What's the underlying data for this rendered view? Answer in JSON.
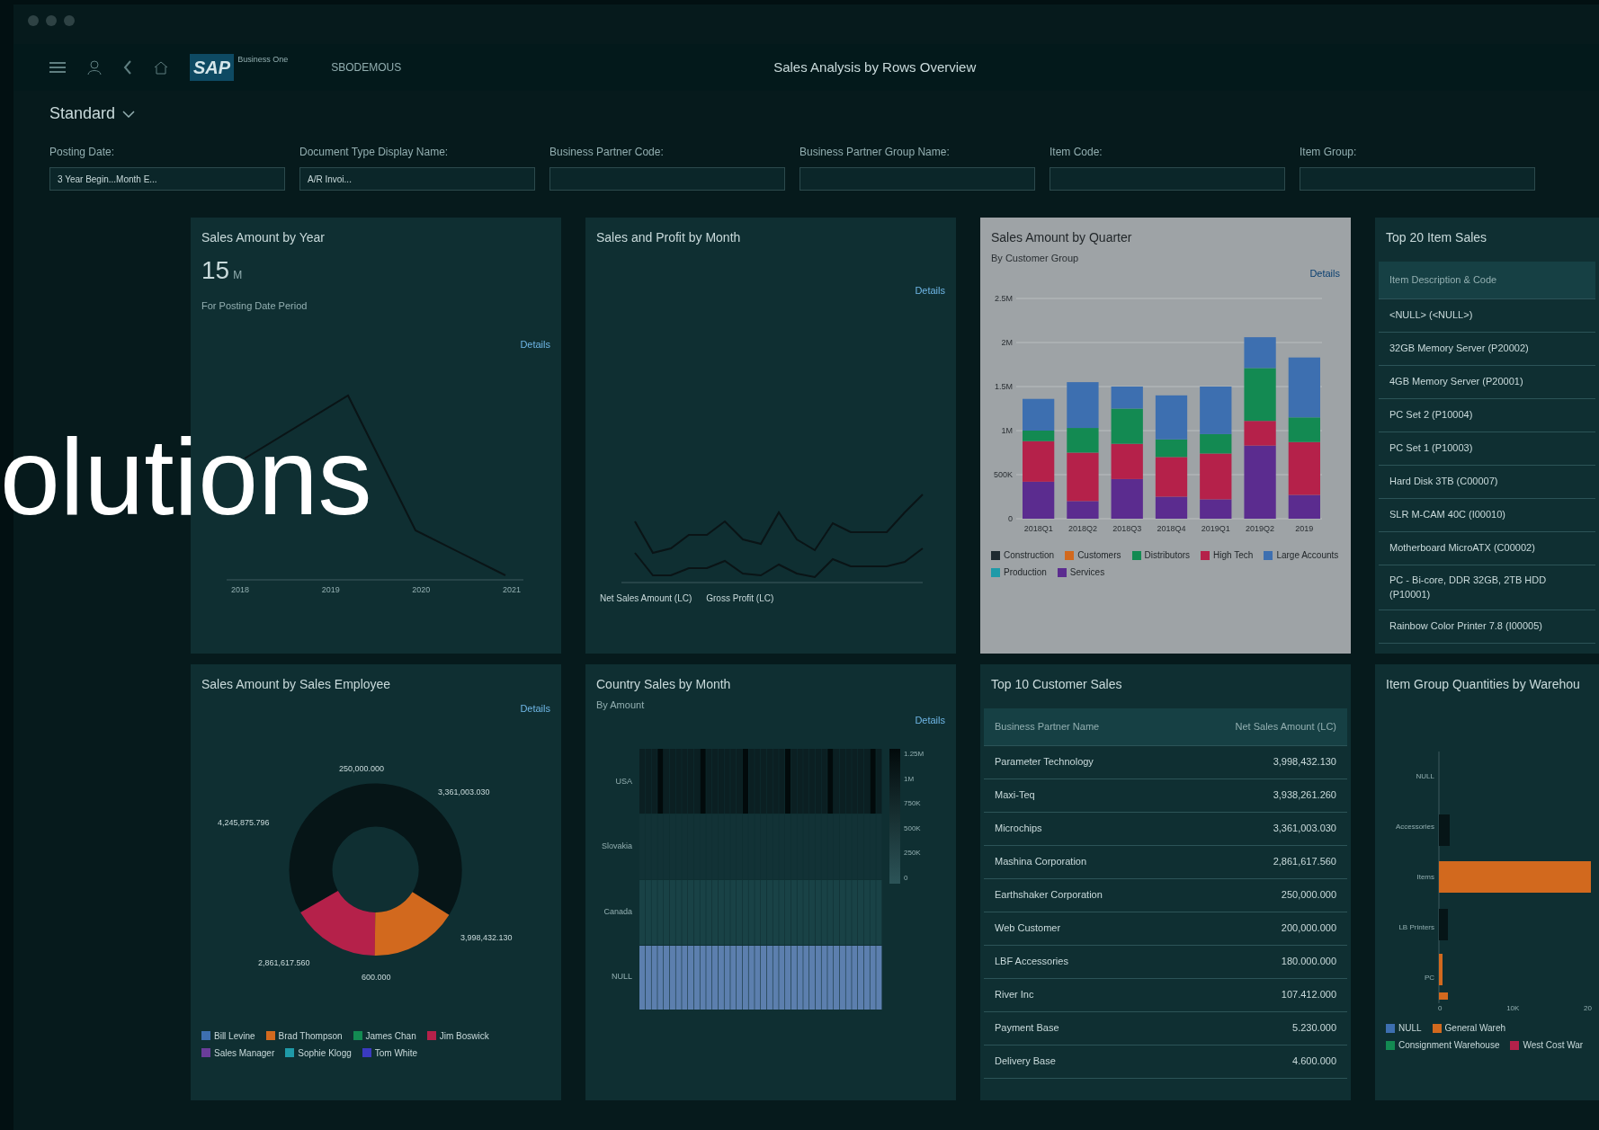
{
  "app_bar": {
    "brand": "SAP",
    "brand_sub": "Business One",
    "company": "SBODEMOUS",
    "title": "Sales Analysis by Rows Overview"
  },
  "variant": "Standard",
  "filters": [
    {
      "label": "Posting Date:",
      "value": "3 Year Begin...Month E..."
    },
    {
      "label": "Document Type Display Name:",
      "value": "A/R Invoi..."
    },
    {
      "label": "Business Partner Code:"
    },
    {
      "label": "Business Partner Group Name:"
    },
    {
      "label": "Item Code:"
    },
    {
      "label": "Item Group:"
    }
  ],
  "headline": "olutions",
  "cards": [
    {
      "kind": "kpi_line",
      "title": "Sales Amount by Year",
      "kpi": "15",
      "unit": "M",
      "subtitle": "For Posting Date Period",
      "link": "Details",
      "x_labels": [
        "2018",
        "2019",
        "2020",
        "2021"
      ]
    },
    {
      "kind": "lines",
      "title": "Sales and Profit by Month",
      "link": "Details",
      "legend": [
        "Net Sales Amount (LC)",
        "Gross Profit (LC)"
      ]
    },
    {
      "kind": "stacked_bar",
      "title": "Sales Amount by Quarter",
      "subtitle": "By Customer Group",
      "link": "Details",
      "chart_data": {
        "type": "bar",
        "stacked": true,
        "legend": "bottom",
        "grid": true,
        "categories": [
          "2018Q1",
          "2018Q2",
          "2018Q3",
          "2018Q4",
          "2019Q1",
          "2019Q2",
          "2019"
        ],
        "ylim": [
          0,
          2500000
        ],
        "yticks": [
          {
            "value": 0,
            "label": "0"
          },
          {
            "value": 500000,
            "label": "500K"
          },
          {
            "value": 1000000,
            "label": "1M"
          },
          {
            "value": 1500000,
            "label": "1.5M"
          },
          {
            "value": 2000000,
            "label": "2M"
          },
          {
            "value": 2500000,
            "label": "2.5M"
          }
        ],
        "series": [
          {
            "name": "Services",
            "color": "#5b2c8f",
            "values": [
              420000,
              200000,
              450000,
              250000,
              220000,
              830000,
              270000
            ]
          },
          {
            "name": "High Tech",
            "color": "#b5214a",
            "values": [
              460000,
              550000,
              400000,
              450000,
              520000,
              280000,
              600000
            ]
          },
          {
            "name": "Distributors",
            "color": "#138a52",
            "values": [
              120000,
              280000,
              400000,
              200000,
              220000,
              600000,
              280000
            ]
          },
          {
            "name": "Large Accounts",
            "color": "#3d6fb0",
            "values": [
              360000,
              520000,
              250000,
              500000,
              540000,
              350000,
              680000
            ]
          }
        ]
      },
      "legend": [
        {
          "label": "Construction",
          "color": "#1e2a30"
        },
        {
          "label": "Customers",
          "color": "#d2691e"
        },
        {
          "label": "Production",
          "color": "#1f9aa8"
        }
      ]
    },
    {
      "kind": "table",
      "title": "Top 20 Item Sales",
      "columns": [
        "Item Description & Code"
      ],
      "rows": [
        [
          "<NULL> (<NULL>)"
        ],
        [
          "32GB Memory Server (P20002)"
        ],
        [
          "4GB Memory Server (P20001)"
        ],
        [
          "PC Set 2 (P10004)"
        ],
        [
          "PC Set 1 (P10003)"
        ],
        [
          "Hard Disk 3TB (C00007)"
        ],
        [
          "SLR M-CAM 40C (I00010)"
        ],
        [
          "Motherboard MicroATX (C00002)"
        ],
        [
          "PC - Bi-core, DDR 32GB, 2TB HDD (P10001)"
        ],
        [
          "Rainbow Color Printer 7.8 (I00005)"
        ]
      ]
    },
    {
      "kind": "donut",
      "title": "Sales Amount by Sales Employee",
      "link": "Details",
      "labels": [
        "250,000.000",
        "3,361,003.030",
        "4,245,875.796",
        "3,998,432.130",
        "2,861,617.560",
        "600.000"
      ],
      "legend": [
        {
          "label": "Bill Levine",
          "color": "#3d6fb0"
        },
        {
          "label": "Brad Thompson",
          "color": "#d2691e"
        },
        {
          "label": "James Chan",
          "color": "#138a52"
        },
        {
          "label": "Jim Boswick",
          "color": "#b5214a"
        },
        {
          "label": "Sales Manager",
          "color": "#6a3d9a"
        },
        {
          "label": "Sophie Klogg",
          "color": "#1f9aa8"
        },
        {
          "label": "Tom White",
          "color": "#3a3ac0"
        }
      ]
    },
    {
      "kind": "heatmap",
      "title": "Country Sales by Month",
      "subtitle": "By Amount",
      "link": "Details",
      "rows": [
        "USA",
        "Slovakia",
        "Canada",
        "NULL"
      ],
      "scale": [
        "1.25M",
        "1M",
        "750K",
        "500K",
        "250K",
        "0"
      ]
    },
    {
      "kind": "table",
      "title": "Top 10 Customer Sales",
      "columns": [
        "Business Partner Name",
        "Net Sales Amount (LC)"
      ],
      "rows": [
        [
          "Parameter Technology",
          "3,998,432.130"
        ],
        [
          "Maxi-Teq",
          "3,938,261.260"
        ],
        [
          "Microchips",
          "3,361,003.030"
        ],
        [
          "Mashina Corporation",
          "2,861,617.560"
        ],
        [
          "Earthshaker Corporation",
          "250,000.000"
        ],
        [
          "Web Customer",
          "200,000.000"
        ],
        [
          "LBF Accessories",
          "180.000.000"
        ],
        [
          "River Inc",
          "107.412.000"
        ],
        [
          "Payment Base",
          "5.230.000"
        ],
        [
          "Delivery Base",
          "4.600.000"
        ]
      ]
    },
    {
      "kind": "hbar",
      "title": "Item Group Quantities by Warehou",
      "labels": [
        "NULL",
        "Accessories",
        "Items",
        "LB Printers",
        "PC"
      ],
      "ticks": [
        "0",
        "10K",
        "20"
      ],
      "legend": [
        {
          "label": "NULL",
          "color": "#3d6fb0"
        },
        {
          "label": "General Wareh",
          "color": "#d2691e"
        },
        {
          "label": "Consignment Warehouse",
          "color": "#138a52"
        },
        {
          "label": "West Cost War",
          "color": "#b5214a"
        }
      ]
    }
  ]
}
